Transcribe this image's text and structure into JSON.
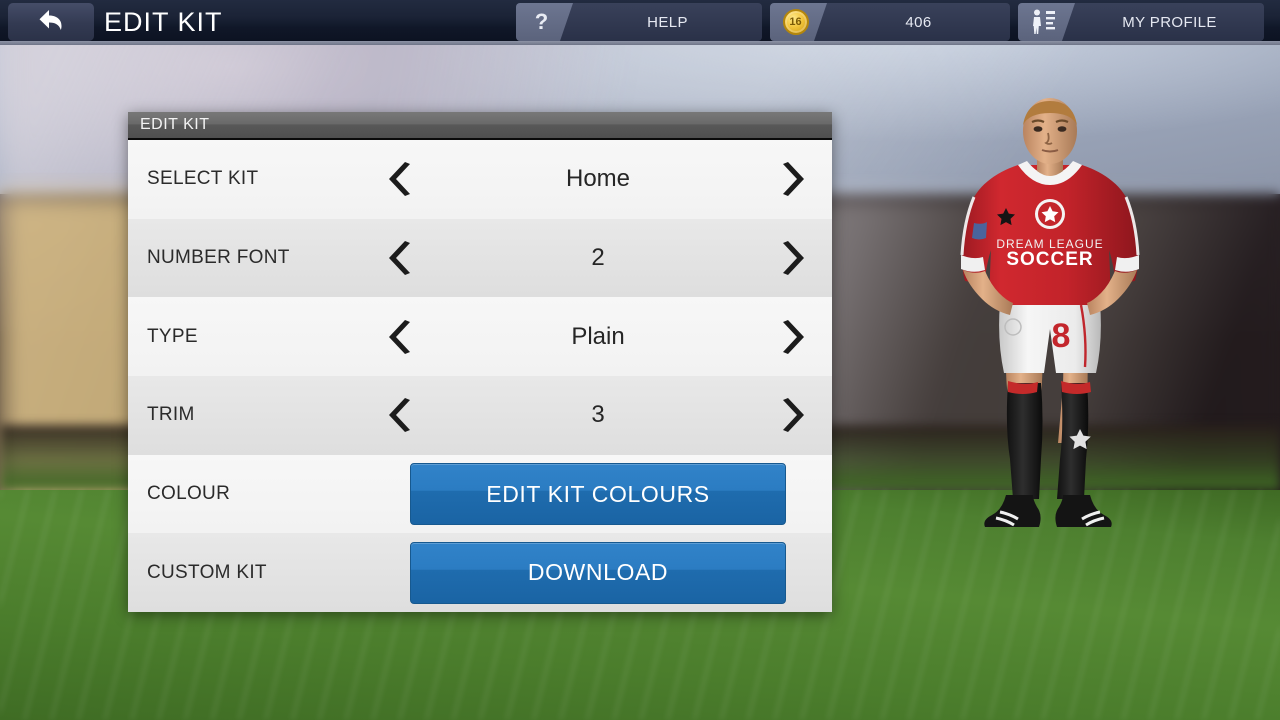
{
  "topbar": {
    "back_icon": "back-arrow-icon",
    "title": "EDIT KIT",
    "help": {
      "icon": "question-mark-icon",
      "icon_glyph": "?",
      "label": "HELP"
    },
    "coins": {
      "icon": "coin-icon",
      "icon_glyph": "16",
      "label": "406"
    },
    "profile": {
      "icon": "player-profile-icon",
      "label": "MY PROFILE"
    }
  },
  "panel": {
    "title": "EDIT KIT",
    "rows": [
      {
        "label": "SELECT KIT",
        "value": "Home",
        "kind": "stepper"
      },
      {
        "label": "NUMBER FONT",
        "value": "2",
        "kind": "stepper"
      },
      {
        "label": "TYPE",
        "value": "Plain",
        "kind": "stepper"
      },
      {
        "label": "TRIM",
        "value": "3",
        "kind": "stepper"
      },
      {
        "label": "COLOUR",
        "value": "EDIT KIT COLOURS",
        "kind": "button"
      },
      {
        "label": "CUSTOM KIT",
        "value": "DOWNLOAD",
        "kind": "button"
      }
    ],
    "prev_icon": "chevron-left-icon",
    "next_icon": "chevron-right-icon"
  },
  "player_preview": {
    "name": "player-kit-preview",
    "shirt_text_line1": "DREAM LEAGUE",
    "shirt_text_line2": "SOCCER",
    "shorts_number": "8"
  },
  "colors": {
    "accent_blue": "#2b7cc2",
    "accent_blue_dark": "#1f6cae",
    "topbar_dark": "#1b2336",
    "panel_title_gray": "#6a6a6a",
    "row_light": "#f4f4f4",
    "row_dark": "#e3e3e3",
    "kit_red": "#c8222a",
    "coin_gold": "#f2c53c"
  }
}
